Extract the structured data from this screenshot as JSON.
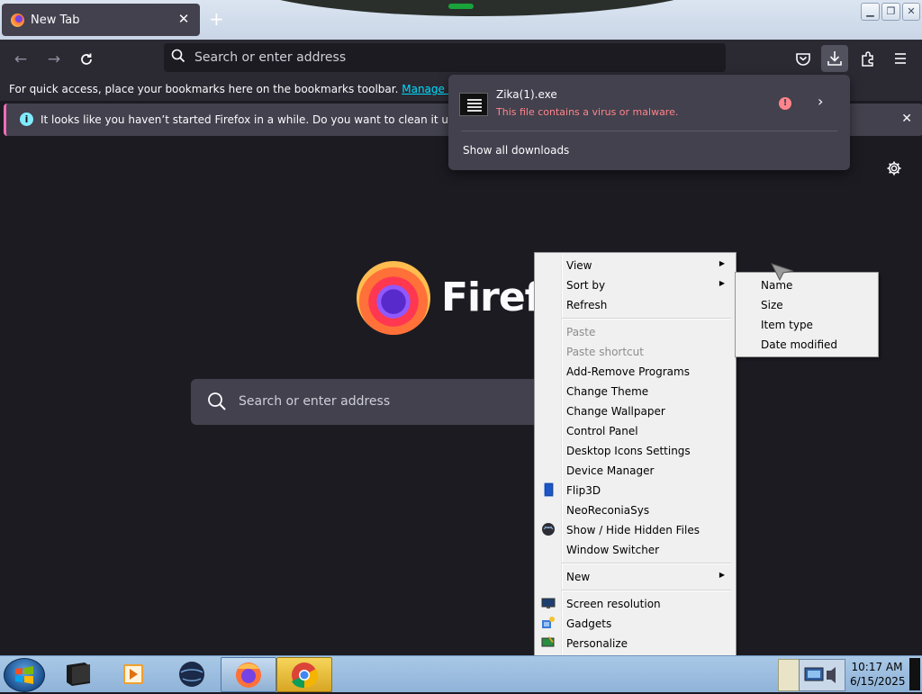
{
  "browser": {
    "tab_title": "New Tab",
    "new_tab_label": "+",
    "address_placeholder": "Search or enter address",
    "bookmarks_bar_text": "For quick access, place your bookmarks here on the bookmarks toolbar.",
    "bookmarks_bar_link": "Manage bookmarks…",
    "notification_text": "It looks like you haven’t started Firefox in a while. Do you want to clean it up for a fresh",
    "brand_text": "Firefox",
    "content_search_placeholder": "Search or enter address"
  },
  "downloads_panel": {
    "file_name": "Zika(1).exe",
    "warning": "This file contains a virus or malware.",
    "show_all": "Show all downloads"
  },
  "context_menu": {
    "items": [
      {
        "label": "View",
        "submenu": true
      },
      {
        "label": "Sort by",
        "submenu": true
      },
      {
        "label": "Refresh"
      },
      {
        "label": "Paste",
        "disabled": true
      },
      {
        "label": "Paste shortcut",
        "disabled": true
      },
      {
        "label": "Add-Remove Programs"
      },
      {
        "label": "Change Theme"
      },
      {
        "label": "Change Wallpaper"
      },
      {
        "label": "Control Panel"
      },
      {
        "label": "Desktop Icons Settings"
      },
      {
        "label": "Device Manager"
      },
      {
        "label": "Flip3D",
        "icon": "flip3d-icon"
      },
      {
        "label": "NeoReconiaSys"
      },
      {
        "label": "Show / Hide Hidden Files",
        "icon": "globe-icon"
      },
      {
        "label": "Window Switcher"
      },
      {
        "label": "New",
        "submenu": true
      },
      {
        "label": "Screen resolution",
        "icon": "monitor-icon"
      },
      {
        "label": "Gadgets",
        "icon": "gadgets-icon"
      },
      {
        "label": "Personalize",
        "icon": "personalize-icon"
      }
    ]
  },
  "sort_submenu": {
    "items": [
      "Name",
      "Size",
      "Item type",
      "Date modified"
    ]
  },
  "taskbar": {
    "time": "10:17 AM",
    "date": "6/15/2025"
  },
  "colors": {
    "browser_bg": "#1c1b22",
    "toolbar": "#2b2a33",
    "panel": "#42414d",
    "warning_red": "#ff848b",
    "link_cyan": "#00ddff"
  }
}
